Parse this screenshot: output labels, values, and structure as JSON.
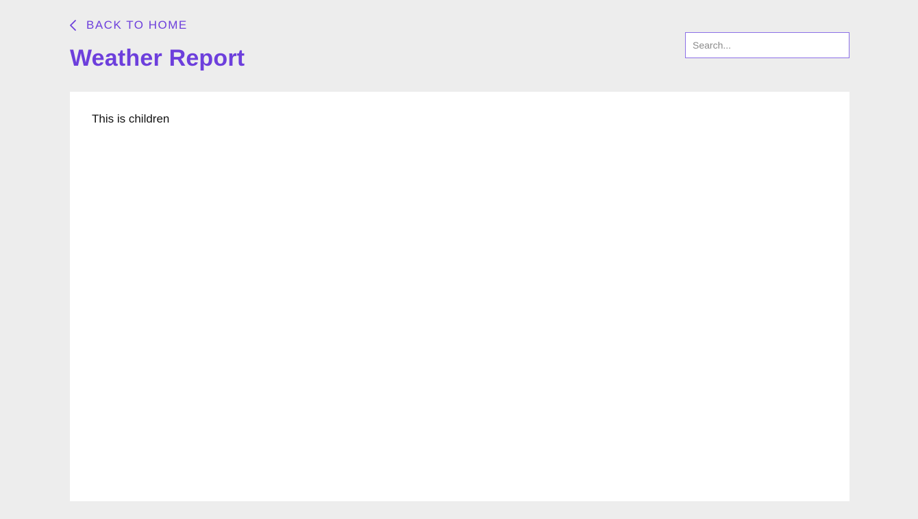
{
  "header": {
    "back_link": {
      "label": "BACK TO HOME",
      "icon": "chevron-left-icon"
    },
    "title": "Weather Report"
  },
  "search": {
    "placeholder": "Search..."
  },
  "main": {
    "children_text": "This is children"
  },
  "colors": {
    "accent": "#6d3fdc",
    "background": "#ededed",
    "panel": "#ffffff",
    "input_border": "#8b6fe6"
  }
}
